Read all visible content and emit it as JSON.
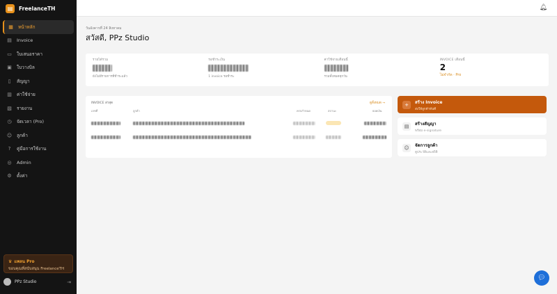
{
  "brand": {
    "name": "FreelanceTH",
    "logo_icon": "document-icon",
    "accent": "#e8911a"
  },
  "nav": [
    {
      "label": "หน้าหลัก",
      "icon": "dashboard-icon",
      "active": true
    },
    {
      "label": "Invoice",
      "icon": "invoice-icon",
      "active": false
    },
    {
      "label": "ใบเสนอราคา",
      "icon": "quote-icon",
      "active": false
    },
    {
      "label": "ใบวางบิล",
      "icon": "bill-icon",
      "active": false
    },
    {
      "label": "สัญญา",
      "icon": "contract-icon",
      "active": false
    },
    {
      "label": "ค่าใช้จ่าย",
      "icon": "expense-icon",
      "active": false
    },
    {
      "label": "รายงาน",
      "icon": "report-icon",
      "active": false
    },
    {
      "label": "จัดเวลา (Pro)",
      "icon": "clock-icon",
      "active": false
    },
    {
      "label": "ลูกค้า",
      "icon": "customer-icon",
      "active": false
    },
    {
      "label": "คู่มือการใช้งาน",
      "icon": "help-icon",
      "active": false
    },
    {
      "label": "Admin",
      "icon": "admin-icon",
      "active": false
    },
    {
      "label": "ตั้งค่า",
      "icon": "gear-icon",
      "active": false
    }
  ],
  "pro": {
    "title": "แพลน Pro",
    "subtitle": "ขอบคุณที่สนับสนุน FreelanceTH"
  },
  "user": {
    "name": "PPz Studio"
  },
  "header": {
    "date": "วันอังคารที่ 24 สิงหาคม",
    "greeting": "สวัสดี, PPz Studio"
  },
  "stats": [
    {
      "label": "รายได้รวม",
      "sub": "ยังไม่มีรายการที่ชำระแล้ว"
    },
    {
      "label": "รอชำระเงิน",
      "sub": "1 invoice รอชำระ"
    },
    {
      "label": "ค่าใช้จ่ายเดือนนี้",
      "sub": "รวมทั้งหมดทุกวัน"
    },
    {
      "label": "INVOICE เดือนนี้",
      "value": "2",
      "sub": "ไม่จำกัด · Pro"
    }
  ],
  "recent": {
    "title": "INVOICE ล่าสุด",
    "view_all": "ดูทั้งหมด →",
    "columns": [
      "เลขที่",
      "ลูกค้า",
      "ครบกำหนด",
      "สถานะ",
      "ยอดเงิน"
    ]
  },
  "actions": [
    {
      "title": "สร้าง Invoice",
      "subtitle": "ส่งให้ลูกค้าทันที",
      "icon": "plus-icon",
      "primary": true
    },
    {
      "title": "สร้างสัญญา",
      "subtitle": "พร้อม e-signature",
      "icon": "contract-icon",
      "primary": false
    },
    {
      "title": "จัดการลูกค้า",
      "subtitle": "ดูประวัติและสถิติ",
      "icon": "customer-icon",
      "primary": false
    }
  ],
  "colors": {
    "primary_action": "#c4590c",
    "chat": "#1e6fd9"
  }
}
